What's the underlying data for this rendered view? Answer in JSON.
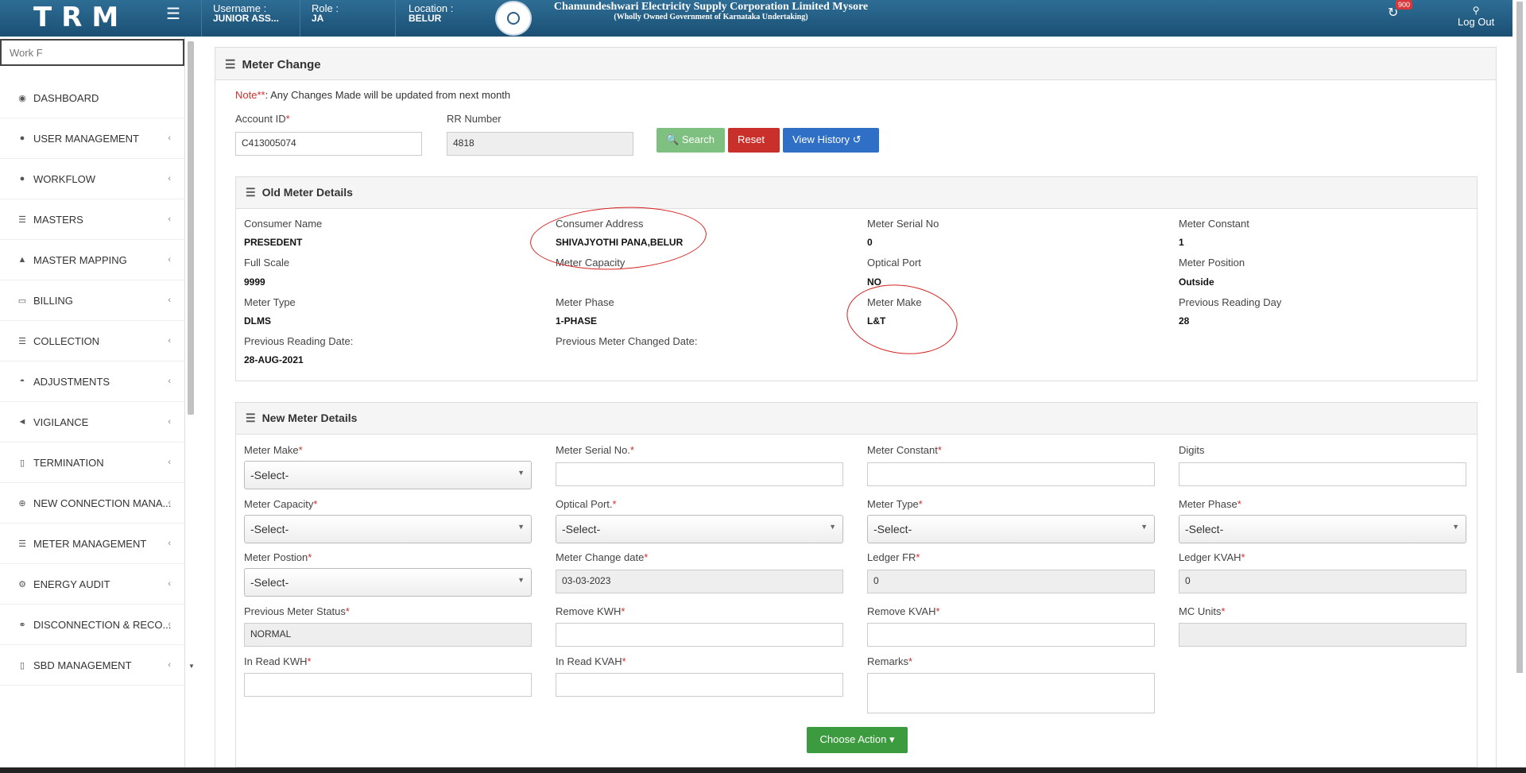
{
  "header": {
    "logo": "TRM",
    "username_label": "Username :",
    "username_value": "JUNIOR ASS...",
    "role_label": "Role :",
    "role_value": "JA",
    "location_label": "Location :",
    "location_value": "BELUR",
    "corp_name": "Chamundeshwari Electricity Supply Corporation Limited Mysore",
    "corp_sub": "(Wholly Owned Government of Karnataka Undertaking)",
    "notif_count": "900",
    "logout": "Log Out"
  },
  "sidebar": {
    "search_placeholder": "Work F",
    "items": [
      {
        "label": "DASHBOARD",
        "icon": "dashboard-icon"
      },
      {
        "label": "USER MANAGEMENT",
        "icon": "user-icon"
      },
      {
        "label": "WORKFLOW",
        "icon": "user-icon"
      },
      {
        "label": "MASTERS",
        "icon": "list-icon"
      },
      {
        "label": "MASTER MAPPING",
        "icon": "sitemap-icon"
      },
      {
        "label": "BILLING",
        "icon": "monitor-icon"
      },
      {
        "label": "COLLECTION",
        "icon": "list-icon"
      },
      {
        "label": "ADJUSTMENTS",
        "icon": "binoculars-icon"
      },
      {
        "label": "VIGILANCE",
        "icon": "vk-icon"
      },
      {
        "label": "TERMINATION",
        "icon": "trash-icon"
      },
      {
        "label": "NEW CONNECTION MANA...",
        "icon": "plus-circle-icon"
      },
      {
        "label": "METER MANAGEMENT",
        "icon": "list-icon"
      },
      {
        "label": "ENERGY AUDIT",
        "icon": "cogs-icon"
      },
      {
        "label": "DISCONNECTION & RECO...",
        "icon": "link-icon"
      },
      {
        "label": "SBD MANAGEMENT",
        "icon": "mobile-icon"
      }
    ]
  },
  "page": {
    "title": "Meter Change",
    "note_prefix": "Note**",
    "note_text": ": Any Changes Made will be updated from next month",
    "account_label": "Account ID",
    "account_value": "C413005074",
    "rr_label": "RR Number",
    "rr_value": "4818",
    "search_btn": "Search",
    "reset_btn": "Reset",
    "history_btn": "View History"
  },
  "old_meter": {
    "title": "Old Meter Details",
    "consumer_name_label": "Consumer Name",
    "consumer_name": "PRESEDENT",
    "consumer_address_label": "Consumer Address",
    "consumer_address": "SHIVAJYOTHI PANA,BELUR",
    "serial_label": "Meter Serial No",
    "serial": "0",
    "constant_label": "Meter Constant",
    "constant": "1",
    "full_scale_label": "Full Scale",
    "full_scale": "9999",
    "capacity_label": "Meter Capacity",
    "capacity": "",
    "optical_label": "Optical Port",
    "optical": "NO",
    "position_label": "Meter Position",
    "position": "Outside",
    "type_label": "Meter Type",
    "type": "DLMS",
    "phase_label": "Meter Phase",
    "phase": "1-PHASE",
    "make_label": "Meter Make",
    "make": "L&T",
    "prev_day_label": "Previous Reading Day",
    "prev_day": "28",
    "prev_date_label": "Previous Reading Date:",
    "prev_date": "28-AUG-2021",
    "prev_changed_label": "Previous Meter Changed Date:"
  },
  "new_meter": {
    "title": "New Meter Details",
    "make_label": "Meter Make",
    "make_value": "-Select-",
    "serial_label": "Meter Serial No.",
    "constant_label": "Meter Constant",
    "digits_label": "Digits",
    "capacity_label": "Meter Capacity",
    "capacity_value": "-Select-",
    "optical_label": "Optical Port.",
    "optical_value": "-Select-",
    "type_label": "Meter Type",
    "type_value": "-Select-",
    "phase_label": "Meter Phase",
    "phase_value": "-Select-",
    "position_label": "Meter Postion",
    "position_value": "-Select-",
    "change_date_label": "Meter Change date",
    "change_date": "03-03-2023",
    "ledger_fr_label": "Ledger FR",
    "ledger_fr": "0",
    "ledger_kvah_label": "Ledger KVAH",
    "ledger_kvah": "0",
    "prev_status_label": "Previous Meter Status",
    "prev_status": "NORMAL",
    "remove_kwh_label": "Remove KWH",
    "remove_kvah_label": "Remove KVAH",
    "mc_units_label": "MC Units",
    "in_read_kwh_label": "In Read KWH",
    "in_read_kvah_label": "In Read KVAH",
    "remarks_label": "Remarks",
    "choose_action": "Choose Action"
  },
  "required_mark": "*"
}
